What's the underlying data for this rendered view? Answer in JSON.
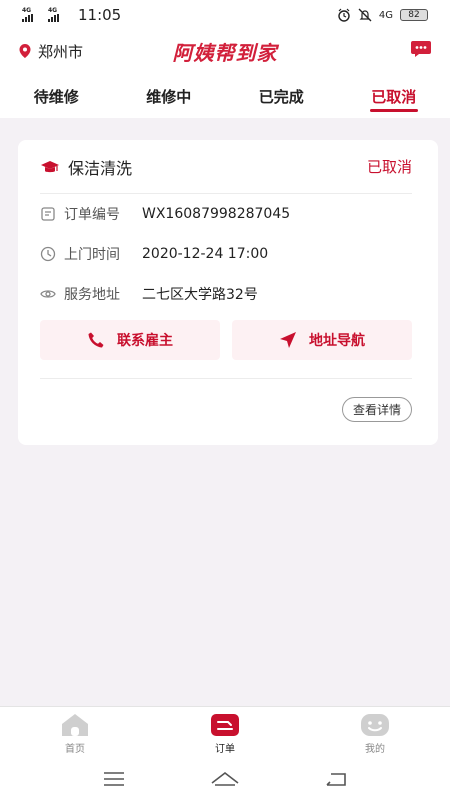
{
  "status_bar": {
    "sig1": "4G",
    "sig2": "4G",
    "time": "11:05",
    "net": "4G",
    "battery": "82"
  },
  "header": {
    "city": "郑州市",
    "title": "阿姨帮到家"
  },
  "tabs": [
    {
      "label": "待维修"
    },
    {
      "label": "维修中"
    },
    {
      "label": "已完成"
    },
    {
      "label": "已取消"
    }
  ],
  "order": {
    "service": "保洁清洗",
    "status": "已取消",
    "number_label": "订单编号",
    "number": "WX16087998287045",
    "time_label": "上门时间",
    "time": "2020-12-24 17:00",
    "address_label": "服务地址",
    "address": "二七区大学路32号",
    "contact_label": "联系雇主",
    "navigate_label": "地址导航",
    "detail_label": "查看详情"
  },
  "tabbar": [
    {
      "label": "首页"
    },
    {
      "label": "订单"
    },
    {
      "label": "我的"
    }
  ],
  "colors": {
    "accent": "#c8102e",
    "accent_bg": "#fdf1f3",
    "page_bg": "#f4f1f5"
  }
}
